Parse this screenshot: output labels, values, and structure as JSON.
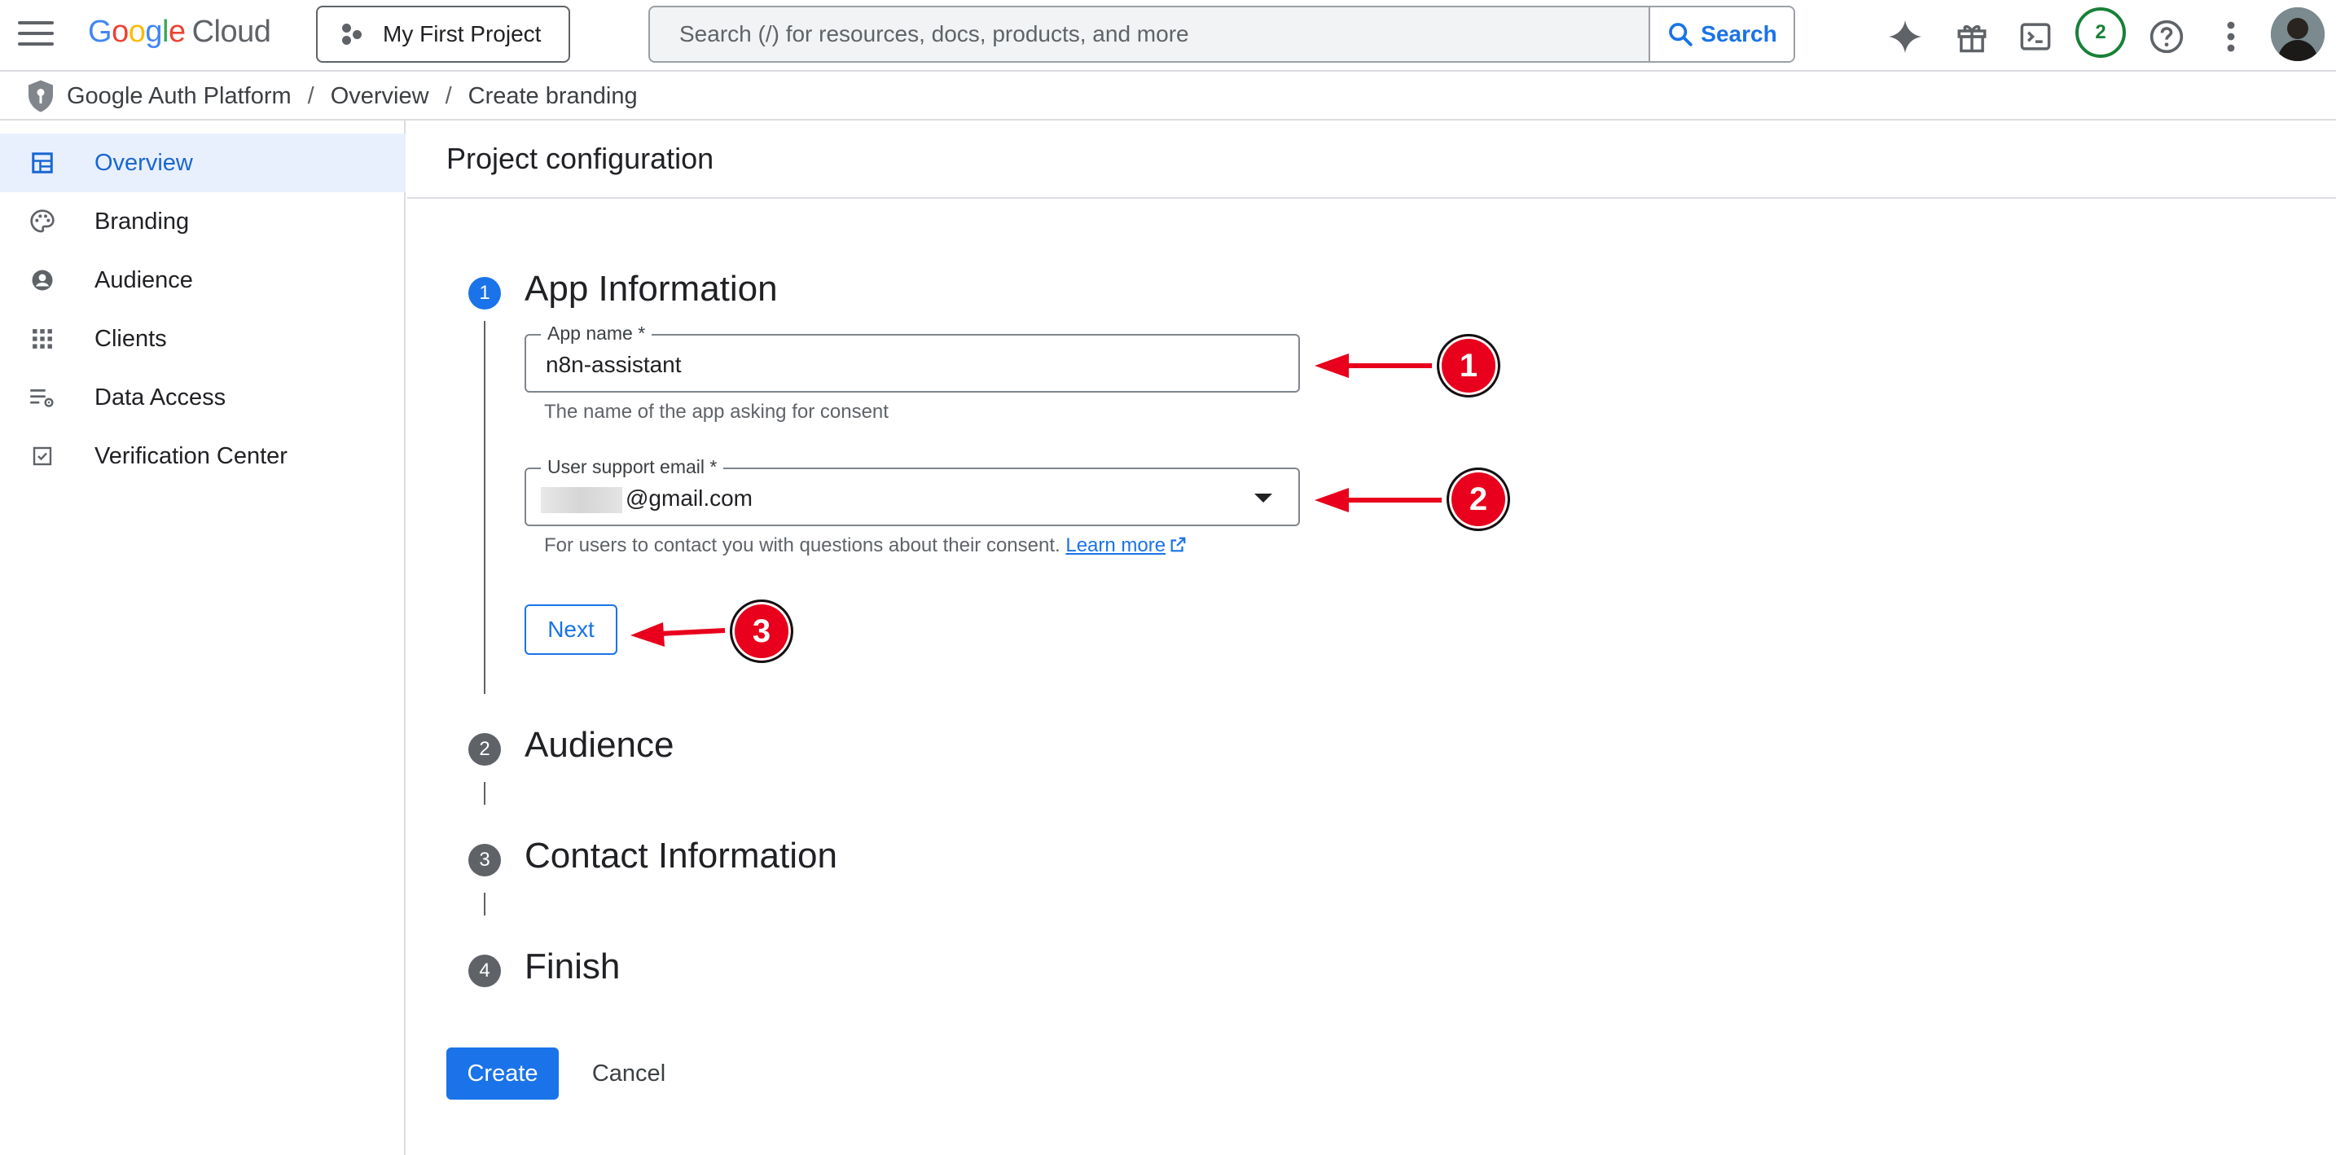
{
  "topbar": {
    "logo": {
      "g": "G",
      "o1": "o",
      "o2": "o",
      "g2": "g",
      "l": "l",
      "e": "e",
      "cloud": "Cloud"
    },
    "project": "My First Project",
    "search_placeholder": "Search (/) for resources, docs, products, and more",
    "search_button": "Search",
    "notification_count": "2",
    "icons": [
      "menu-icon",
      "gemini-sparkle-icon",
      "gift-icon",
      "cloud-shell-icon",
      "help-icon",
      "more-vert-icon"
    ]
  },
  "breadcrumb": {
    "root": "Google Auth Platform",
    "sep": "/",
    "level2": "Overview",
    "current": "Create branding"
  },
  "sidebar": {
    "items": [
      {
        "label": "Overview",
        "icon": "dashboard-icon",
        "active": true
      },
      {
        "label": "Branding",
        "icon": "palette-icon",
        "active": false
      },
      {
        "label": "Audience",
        "icon": "account-circle-icon",
        "active": false
      },
      {
        "label": "Clients",
        "icon": "apps-grid-icon",
        "active": false
      },
      {
        "label": "Data Access",
        "icon": "list-settings-icon",
        "active": false
      },
      {
        "label": "Verification Center",
        "icon": "check-box-icon",
        "active": false
      }
    ]
  },
  "main": {
    "title": "Project configuration",
    "steps": [
      {
        "num": "1",
        "title": "App Information"
      },
      {
        "num": "2",
        "title": "Audience"
      },
      {
        "num": "3",
        "title": "Contact Information"
      },
      {
        "num": "4",
        "title": "Finish"
      }
    ],
    "app_name": {
      "label": "App name *",
      "value": "n8n-assistant",
      "hint": "The name of the app asking for consent"
    },
    "support_email": {
      "label": "User support email *",
      "value": "@gmail.com",
      "hint": "For users to contact you with questions about their consent.",
      "learn_more": "Learn more"
    },
    "next_button": "Next",
    "create_button": "Create",
    "cancel_button": "Cancel"
  },
  "annotations": [
    "1",
    "2",
    "3"
  ],
  "colors": {
    "accent": "#1a73e8",
    "annotation_red": "#e8001c",
    "active_nav_bg": "#e8f0fe",
    "notification_green": "#188038"
  }
}
